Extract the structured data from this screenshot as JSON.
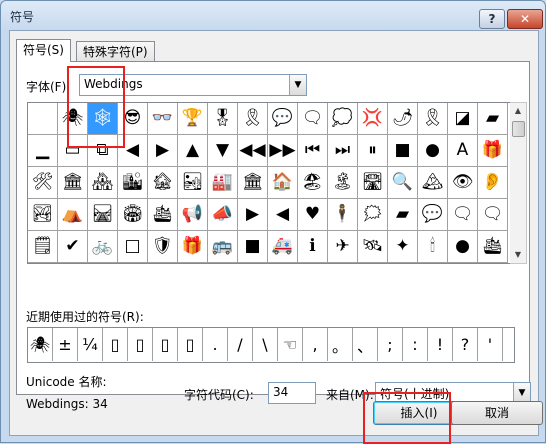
{
  "window": {
    "title": "符号",
    "help_label": "?",
    "close_label": "✕"
  },
  "tabs": [
    {
      "label": "符号(S)",
      "active": true
    },
    {
      "label": "特殊字符(P)",
      "active": false
    }
  ],
  "font": {
    "label": "字体(F):",
    "value": "Webdings"
  },
  "grid": {
    "rows": [
      [
        "",
        "🕷",
        "🕸",
        "😎",
        "👓",
        "🏆",
        "🎖",
        "🎗",
        "💬",
        "🗨",
        "💭",
        "💢",
        "🌶",
        "🎗",
        "◪",
        "▰"
      ],
      [
        "▁",
        "▭",
        "⧉",
        "◀",
        "▶",
        "▲",
        "▼",
        "◀◀",
        "▶▶",
        "⏮",
        "⏭",
        "⏸",
        "■",
        "●",
        "A",
        "🎁"
      ],
      [
        "🛠",
        "🏛",
        "🏘",
        "🏙",
        "🏚",
        "🏜",
        "🏭",
        "🏛",
        "🏠",
        "🏖",
        "🏝",
        "🛣",
        "🔍",
        "🏔",
        "👁",
        "👂"
      ],
      [
        "🏞",
        "⛺",
        "🛤",
        "🏟",
        "🛳",
        "📢",
        "📣",
        "▶",
        "◀",
        "♥",
        "🕴",
        "🗯",
        "▰",
        "💬",
        "🗨",
        "🗨"
      ],
      [
        "🗒",
        "✔",
        "🚲",
        "□",
        "🛡",
        "🎁",
        "🚌",
        "■",
        "🚑",
        "ℹ",
        "✈",
        "🛰",
        "✦",
        "🕯",
        "●",
        "🛳"
      ]
    ],
    "selected_symbol": "🕸"
  },
  "recent": {
    "label": "近期使用过的符号(R):",
    "symbols": [
      "🕷",
      "±",
      "¼",
      "▯",
      "▯",
      "▯",
      "▯",
      ".",
      "/",
      "\\",
      "☜",
      ",",
      "。",
      "、",
      ";",
      ":",
      "!",
      "?",
      "'"
    ]
  },
  "unicode_name_label": "Unicode 名称:",
  "charset_name": "Webdings: 34",
  "char_code": {
    "label": "字符代码(C):",
    "value": "34"
  },
  "from": {
    "label": "来自(M):",
    "value": "符号(十进制)"
  },
  "buttons": {
    "insert": "插入(I)",
    "cancel": "取消"
  }
}
